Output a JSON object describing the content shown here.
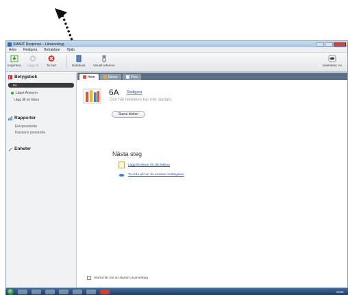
{
  "window": {
    "title": "SMART Response – Lärarverktyg"
  },
  "menu": {
    "items": [
      "Arkiv",
      "Redigera",
      "Betraktare",
      "Hjälp"
    ]
  },
  "toolbar": {
    "import_label": "Importera",
    "add_label": "Lägg till",
    "delete_label": "Ta bort",
    "notebook_label": "Notebook",
    "visual_ref_label": "Visuell referens",
    "secret_label": "Sekretess: Av"
  },
  "sidebar": {
    "gradebook_title": "Betygsbok",
    "class_selected": "6A",
    "mode_label": "Läget Anonym",
    "add_class_label": "Lägg till en klass",
    "reports_title": "Rapporter",
    "report_items": [
      "Elevprestanda",
      "Klassens prestanda"
    ],
    "devices_title": "Enheter"
  },
  "tabs": [
    {
      "label": "Hem",
      "active": true
    },
    {
      "label": "Elever",
      "active": false
    },
    {
      "label": "Prov",
      "active": false
    }
  ],
  "main": {
    "class_name": "6A",
    "edit_label": "Redigera",
    "status_text": "Den här lektionen har inte startats.",
    "start_button_label": "Starta lektion",
    "next_steps_title": "Nästa steg",
    "next_step_1": "Lägg till elever för din lektion",
    "next_step_2": "Ta reda på hur du ansluter mottagaren",
    "startup_checkbox_label": "Starta här när du startar Lärarverktyg"
  },
  "taskbar": {
    "clock": "10:21"
  },
  "colors": {
    "accent_red": "#c9342e",
    "link_blue": "#1d4fb8",
    "status_green": "#2fa52c",
    "tab_bar": "#5b6f86"
  },
  "icons": {
    "gradebook": "gradebook-icon",
    "reports": "bar-chart-icon",
    "devices": "pencil-icon"
  }
}
